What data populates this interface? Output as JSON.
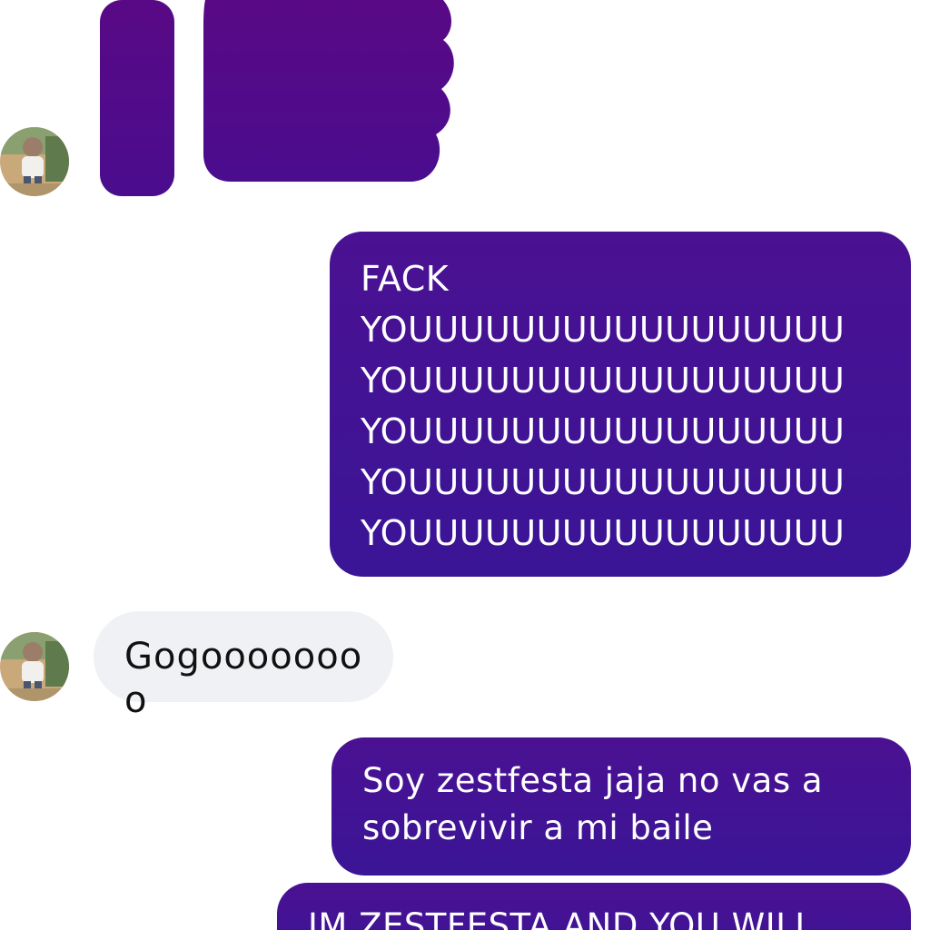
{
  "conversation": {
    "messages": [
      {
        "sender": "them",
        "kind": "sticker",
        "icon": "thumbs-up-icon",
        "color": "#52098a"
      },
      {
        "sender": "me",
        "kind": "text",
        "text": "FACK\nYOUUUUUUUUUUUUUUUUU\nYOUUUUUUUUUUUUUUUUU\nYOUUUUUUUUUUUUUUUUU\nYOUUUUUUUUUUUUUUUUU\nYOUUUUUUUUUUUUUUUUU"
      },
      {
        "sender": "them",
        "kind": "text",
        "text": "Gogoooooooo"
      },
      {
        "sender": "me",
        "kind": "text",
        "text": "Soy zestfesta jaja no vas a sobrevivir a mi baile"
      },
      {
        "sender": "me",
        "kind": "text",
        "text": "IM ZESTFESTA AND YOU WILL"
      }
    ]
  },
  "theme": {
    "outgoing_bubble": "#3e1594",
    "incoming_bubble": "#f0f1f4",
    "background": "#ffffff"
  }
}
